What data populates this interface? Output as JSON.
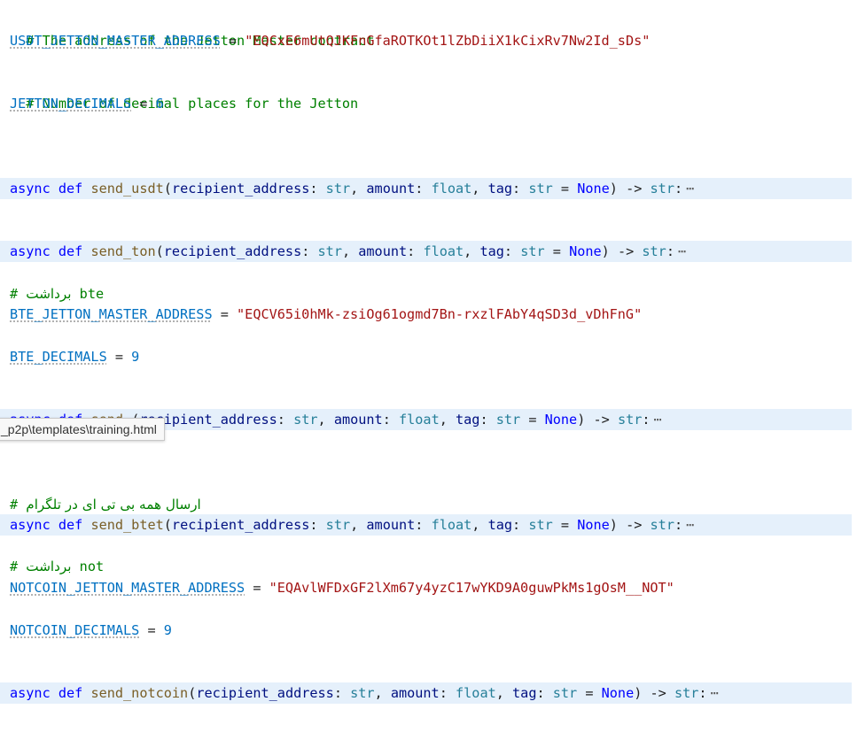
{
  "lines": {
    "comment_master": "# The address of the Jetton Master contract",
    "usdt_name": "USDT_JETTON_MASTER_ADDRESS",
    "usdt_value": "\"EQCxE6mUtQJKFnGfaROTKOt1lZbDiiX1kCixRv7Nw2Id_sDs\"",
    "comment_decimals": "# Number of decimal places for the Jetton",
    "decimals_name": "JETTON_DECIMALS",
    "decimals_value": "6",
    "bte_comment_prefix": "# ",
    "bte_comment_rtl": "برداشت",
    "bte_comment_suffix": " bte",
    "bte_name": "BTE_JETTON_MASTER_ADDRESS",
    "bte_value": "\"EQCV65i0hMk-zsiOg61ogmd7Bn-rxzlFAbY4qSD3d_vDhFnG\"",
    "bte_dec_name": "BTE_DECIMALS",
    "bte_dec_value": "9",
    "telegram_comment_prefix": "# ",
    "telegram_comment_rtl": "ارسال همه بی تی ای در تلگرام",
    "not_comment_prefix": "# ",
    "not_comment_rtl": "برداشت",
    "not_comment_suffix": " not",
    "notcoin_name": "NOTCOIN_JETTON_MASTER_ADDRESS",
    "notcoin_value": "\"EQAvlWFDxGF2lXm67y4yzC17wYKD9A0guwPkMs1gOsM__NOT\"",
    "notcoin_dec_name": "NOTCOIN_DECIMALS",
    "notcoin_dec_value": "9"
  },
  "functions": [
    {
      "name": "send_usdt"
    },
    {
      "name": "send_ton"
    },
    {
      "name": "send_"
    },
    {
      "name": "send_btet"
    },
    {
      "name": "send_notcoin"
    }
  ],
  "signature": {
    "async": "async",
    "def": "def",
    "p1": "recipient_address",
    "p2": "amount",
    "p3": "tag",
    "t_str": "str",
    "t_float": "float",
    "none": "None",
    "arrow": "->",
    "ellipsis": "⋯"
  },
  "tooltip": {
    "text": "_p2p\\templates\\training.html"
  },
  "colors": {
    "folded_bg": "#e5f0fb",
    "comment": "#008000",
    "variable": "#0070c1",
    "string": "#a31515",
    "keyword": "#0000ff",
    "function": "#795e26",
    "type": "#267f99"
  }
}
